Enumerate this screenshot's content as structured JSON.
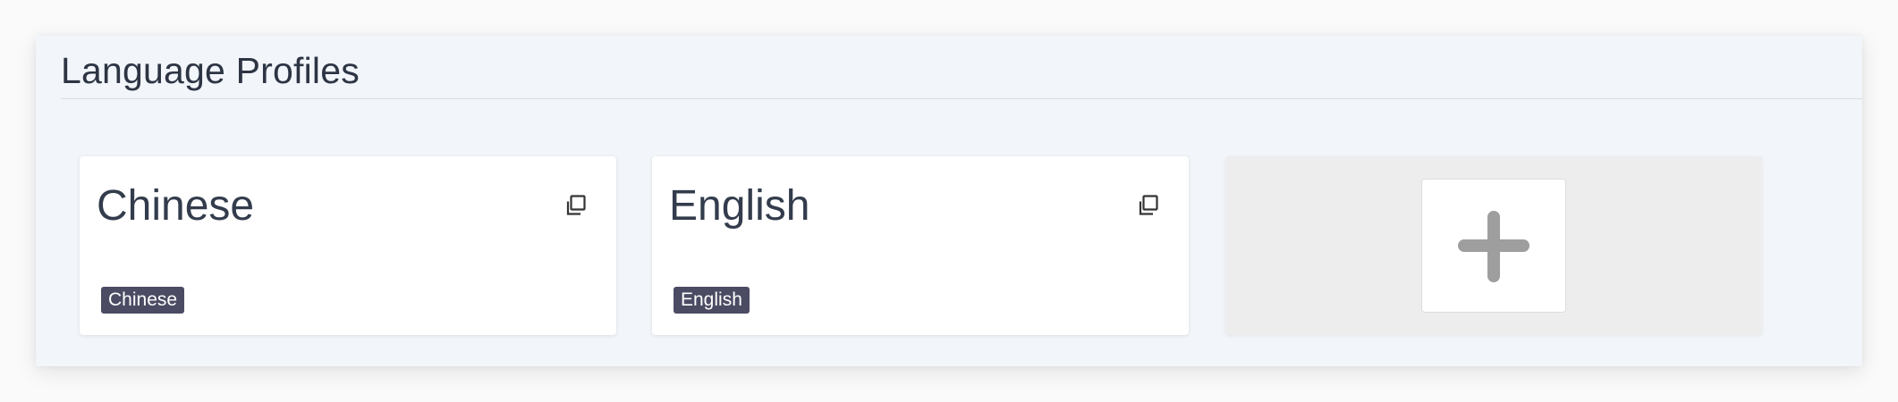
{
  "section": {
    "title": "Language Profiles"
  },
  "profiles": [
    {
      "name": "Chinese",
      "tag": "Chinese"
    },
    {
      "name": "English",
      "tag": "English"
    }
  ],
  "icons": {
    "clone": "clone-icon",
    "add": "plus-icon"
  },
  "colors": {
    "panel_bg": "#f2f5f9",
    "tag_bg": "#4b4c63",
    "add_card_bg": "#ededed",
    "plus": "#9e9e9e"
  }
}
